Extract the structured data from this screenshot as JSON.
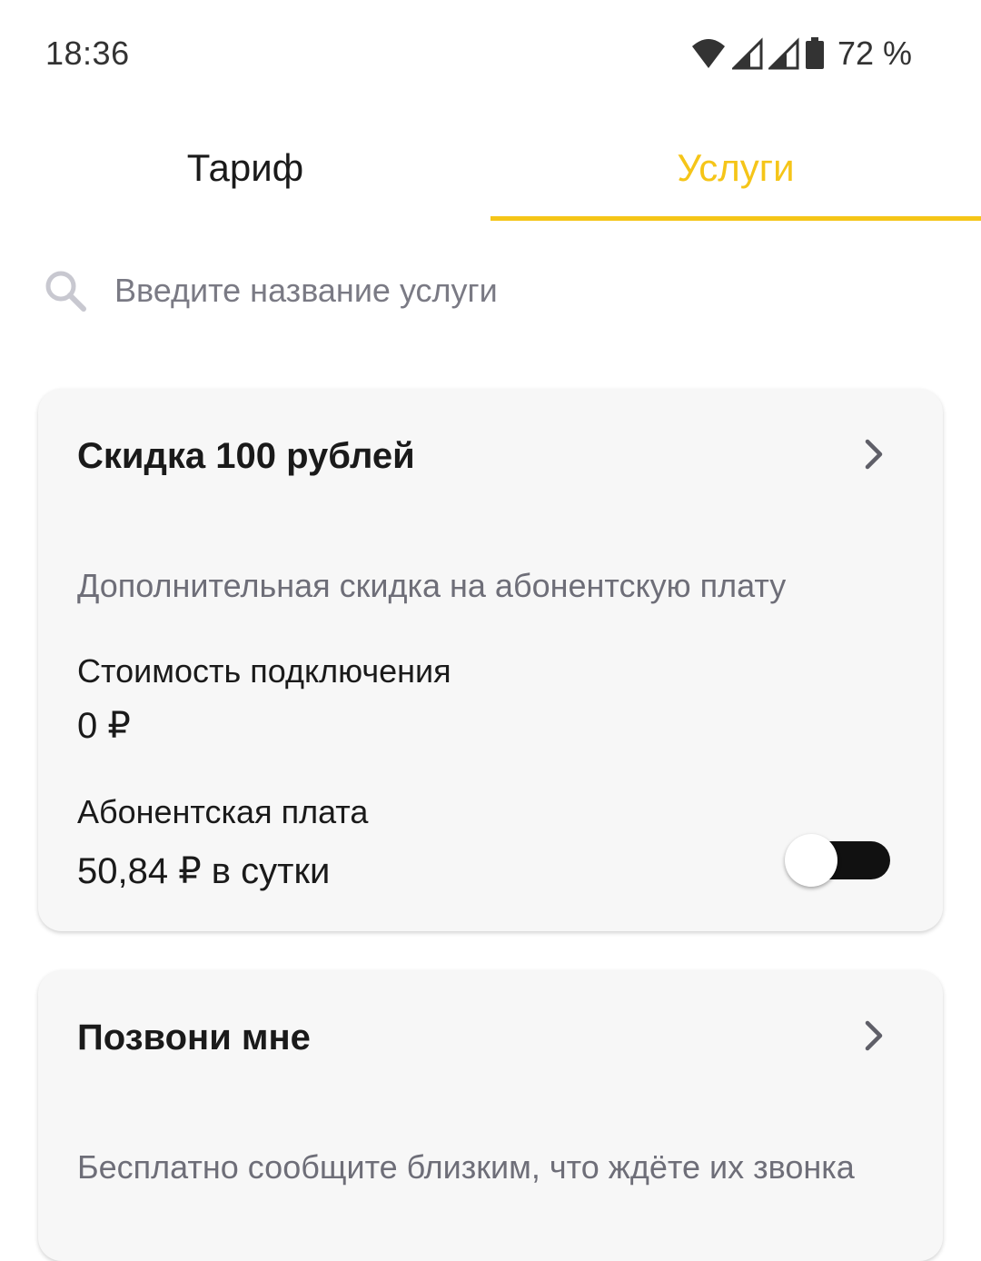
{
  "status_bar": {
    "time": "18:36",
    "battery": "72 %",
    "icons": [
      "wifi-icon",
      "signal-icon",
      "signal-icon",
      "battery-icon"
    ]
  },
  "tabs": [
    {
      "label": "Тариф",
      "active": false
    },
    {
      "label": "Услуги",
      "active": true
    }
  ],
  "search": {
    "placeholder": "Введите название услуги",
    "value": ""
  },
  "cards": [
    {
      "title": "Скидка 100 рублей",
      "description": "Дополнительная скидка на абонентскую плату",
      "connect_label": "Стоимость подключения",
      "connect_value": "0 ₽",
      "fee_label": "Абонентская плата",
      "fee_value": "50,84 ₽ в сутки",
      "toggle_on": false
    },
    {
      "title": "Позвони мне",
      "description": "Бесплатно сообщите близким, что ждёте их звонка"
    }
  ],
  "colors": {
    "accent": "#f5c518",
    "card_bg": "#f7f7f7",
    "secondary_text": "#6e6e78"
  }
}
